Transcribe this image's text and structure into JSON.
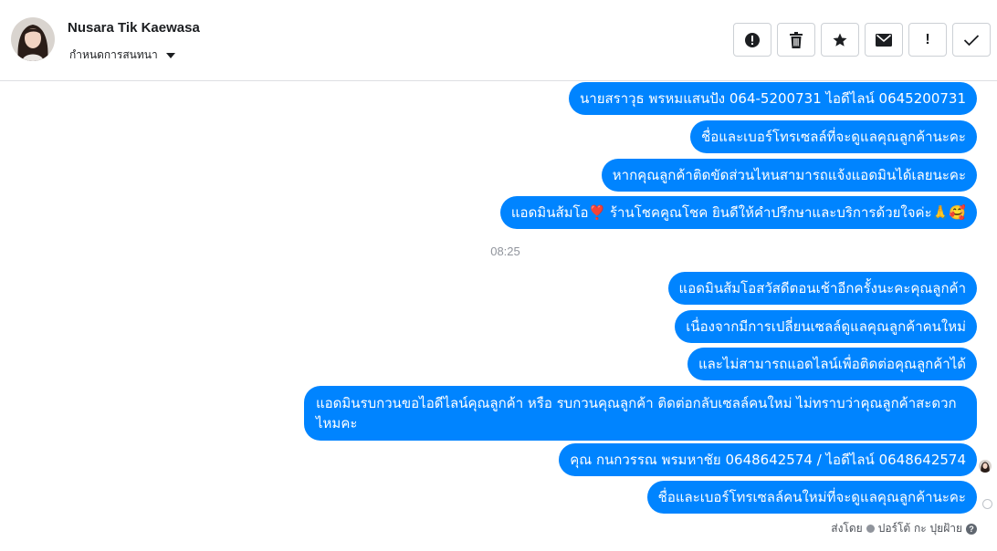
{
  "header": {
    "contact_name": "Nusara Tik Kaewasa",
    "assign_label": "กำหนดการสนทนา",
    "actions": [
      {
        "icon": "alert-circle-icon"
      },
      {
        "icon": "trash-icon"
      },
      {
        "icon": "star-icon"
      },
      {
        "icon": "mail-icon"
      },
      {
        "label": "!"
      },
      {
        "icon": "check-icon"
      }
    ]
  },
  "messages_before": [
    "นายสราวุธ พรหมแสนปัง        064-5200731 ไอดีไลน์ 0645200731",
    "ชื่อและเบอร์โทรเซลล์ที่จะดูแลคุณลูกค้านะคะ",
    "หากคุณลูกค้าติดขัดส่วนไหนสามารถแจ้งแอดมินได้เลยนะคะ",
    "แอดมินส้มโอ❣️ ร้านโชคคูณโชค ยินดีให้คำปรึกษาและบริการด้วยใจค่ะ🙏🥰"
  ],
  "timestamp": "08:25",
  "messages_after": [
    "แอดมินส้มโอสวัสดีตอนเช้าอีกครั้งนะคะคุณลูกค้า",
    "เนื่องจากมีการเปลี่ยนเซลล์ดูแลคุณลูกค้าคนใหม่",
    "และไม่สามารถแอดไลน์เพื่อติดต่อคุณลูกค้าได้",
    "แอดมินรบกวนขอไอดีไลน์คุณลูกค้า หรือ รบกวนคุณลูกค้า ติดต่อกลับเซลล์คนใหม่ ไม่ทราบว่าคุณลูกค้าสะดวกไหมคะ",
    "คุณ กนกวรรณ พรมหาชัย        0648642574 / ไอดีไลน์ 0648642574",
    "ชื่อและเบอร์โทรเซลล์คนใหม่ที่จะดูแลคุณลูกค้านะคะ"
  ],
  "footer": {
    "sent_by_label": "ส่งโดย",
    "sender_name": "ปอร์โต้ กะ ปุยฝ้าย"
  },
  "colors": {
    "bubble": "#0084ff",
    "header_border": "#dddfe2"
  }
}
